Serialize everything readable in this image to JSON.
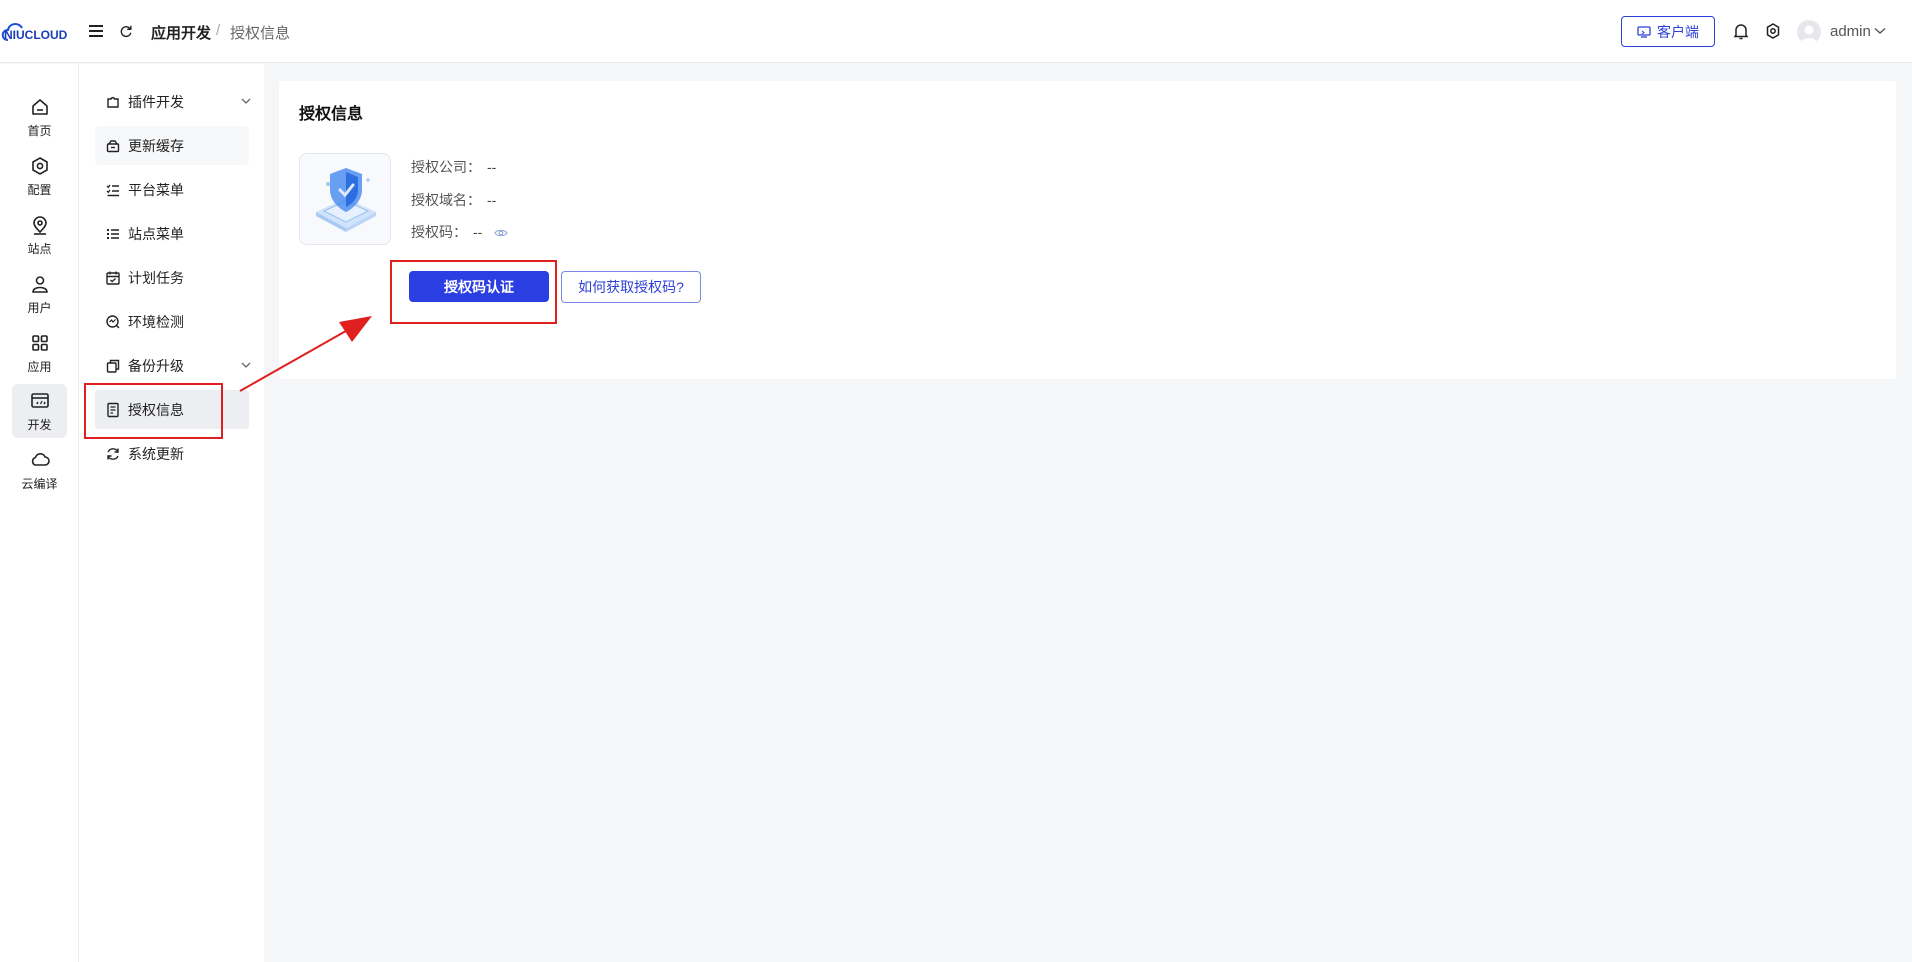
{
  "header": {
    "logo_text": "NIUCLOUD",
    "breadcrumb": {
      "parent": "应用开发",
      "separator": "/",
      "current": "授权信息"
    },
    "client_button": "客户端",
    "user_name": "admin"
  },
  "rail": {
    "items": [
      {
        "label": "首页",
        "icon": "home-icon"
      },
      {
        "label": "配置",
        "icon": "settings-hex-icon"
      },
      {
        "label": "站点",
        "icon": "location-pin-icon"
      },
      {
        "label": "用户",
        "icon": "user-icon"
      },
      {
        "label": "应用",
        "icon": "grid-apps-icon"
      },
      {
        "label": "开发",
        "icon": "code-window-icon",
        "active": true
      },
      {
        "label": "云编译",
        "icon": "cloud-icon"
      }
    ]
  },
  "submenu": {
    "items": [
      {
        "label": "插件开发",
        "icon": "plugin-icon",
        "expandable": true
      },
      {
        "label": "更新缓存",
        "icon": "cache-icon"
      },
      {
        "label": "平台菜单",
        "icon": "checklist-icon"
      },
      {
        "label": "站点菜单",
        "icon": "list-icon"
      },
      {
        "label": "计划任务",
        "icon": "calendar-check-icon"
      },
      {
        "label": "环境检测",
        "icon": "monitor-check-icon"
      },
      {
        "label": "备份升级",
        "icon": "copy-icon",
        "expandable": true
      },
      {
        "label": "授权信息",
        "icon": "document-icon",
        "active": true
      },
      {
        "label": "系统更新",
        "icon": "refresh-icon"
      }
    ]
  },
  "main": {
    "title": "授权信息",
    "fields": [
      {
        "label": "授权公司：",
        "value": "--"
      },
      {
        "label": "授权域名：",
        "value": "--"
      },
      {
        "label": "授权码：",
        "value": "--"
      }
    ],
    "primary_button": "授权码认证",
    "secondary_button": "如何获取授权码?"
  },
  "colors": {
    "accent": "#2b3ee2",
    "annotation": "#e0201f",
    "background": "#f5f6f8"
  }
}
